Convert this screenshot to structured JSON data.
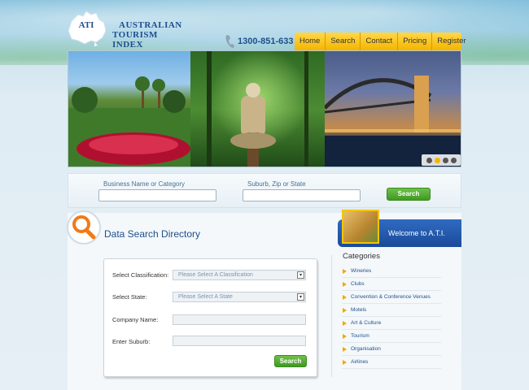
{
  "logo": {
    "abbr": "ATI",
    "line1": "AUSTRALIAN",
    "line2": "TOURISM  INDEX"
  },
  "header": {
    "phone": "1300-851-633",
    "nav": [
      "Home",
      "Search",
      "Contact",
      "Pricing",
      "Register"
    ]
  },
  "slider": {
    "dots": 4,
    "active_dot": 1
  },
  "search_bar": {
    "business_label": "Business Name or Category",
    "business_value": "",
    "location_label": "Suburb, Zip or State",
    "location_value": "",
    "button": "Search"
  },
  "directory": {
    "title": "Data Search Directory",
    "classification_label": "Select Classification:",
    "classification_value": "Please Select A Classification",
    "state_label": "Select State:",
    "state_value": "Please Select A State",
    "company_label": "Company Name:",
    "suburb_label": "Enter Suburb:",
    "button": "Search"
  },
  "sidebar": {
    "welcome": "Welcome to A.T.I.",
    "categories_title": "Categories",
    "categories": [
      "Wineries",
      "Clubs",
      "Convention & Conference Venues",
      "Motels",
      "Art & Culture",
      "Tourism",
      "Organisation",
      "Airlines"
    ]
  },
  "colors": {
    "nav_yellow": "#f5b400",
    "brand_blue": "#1f4f8a",
    "button_green": "#4aa82a"
  }
}
